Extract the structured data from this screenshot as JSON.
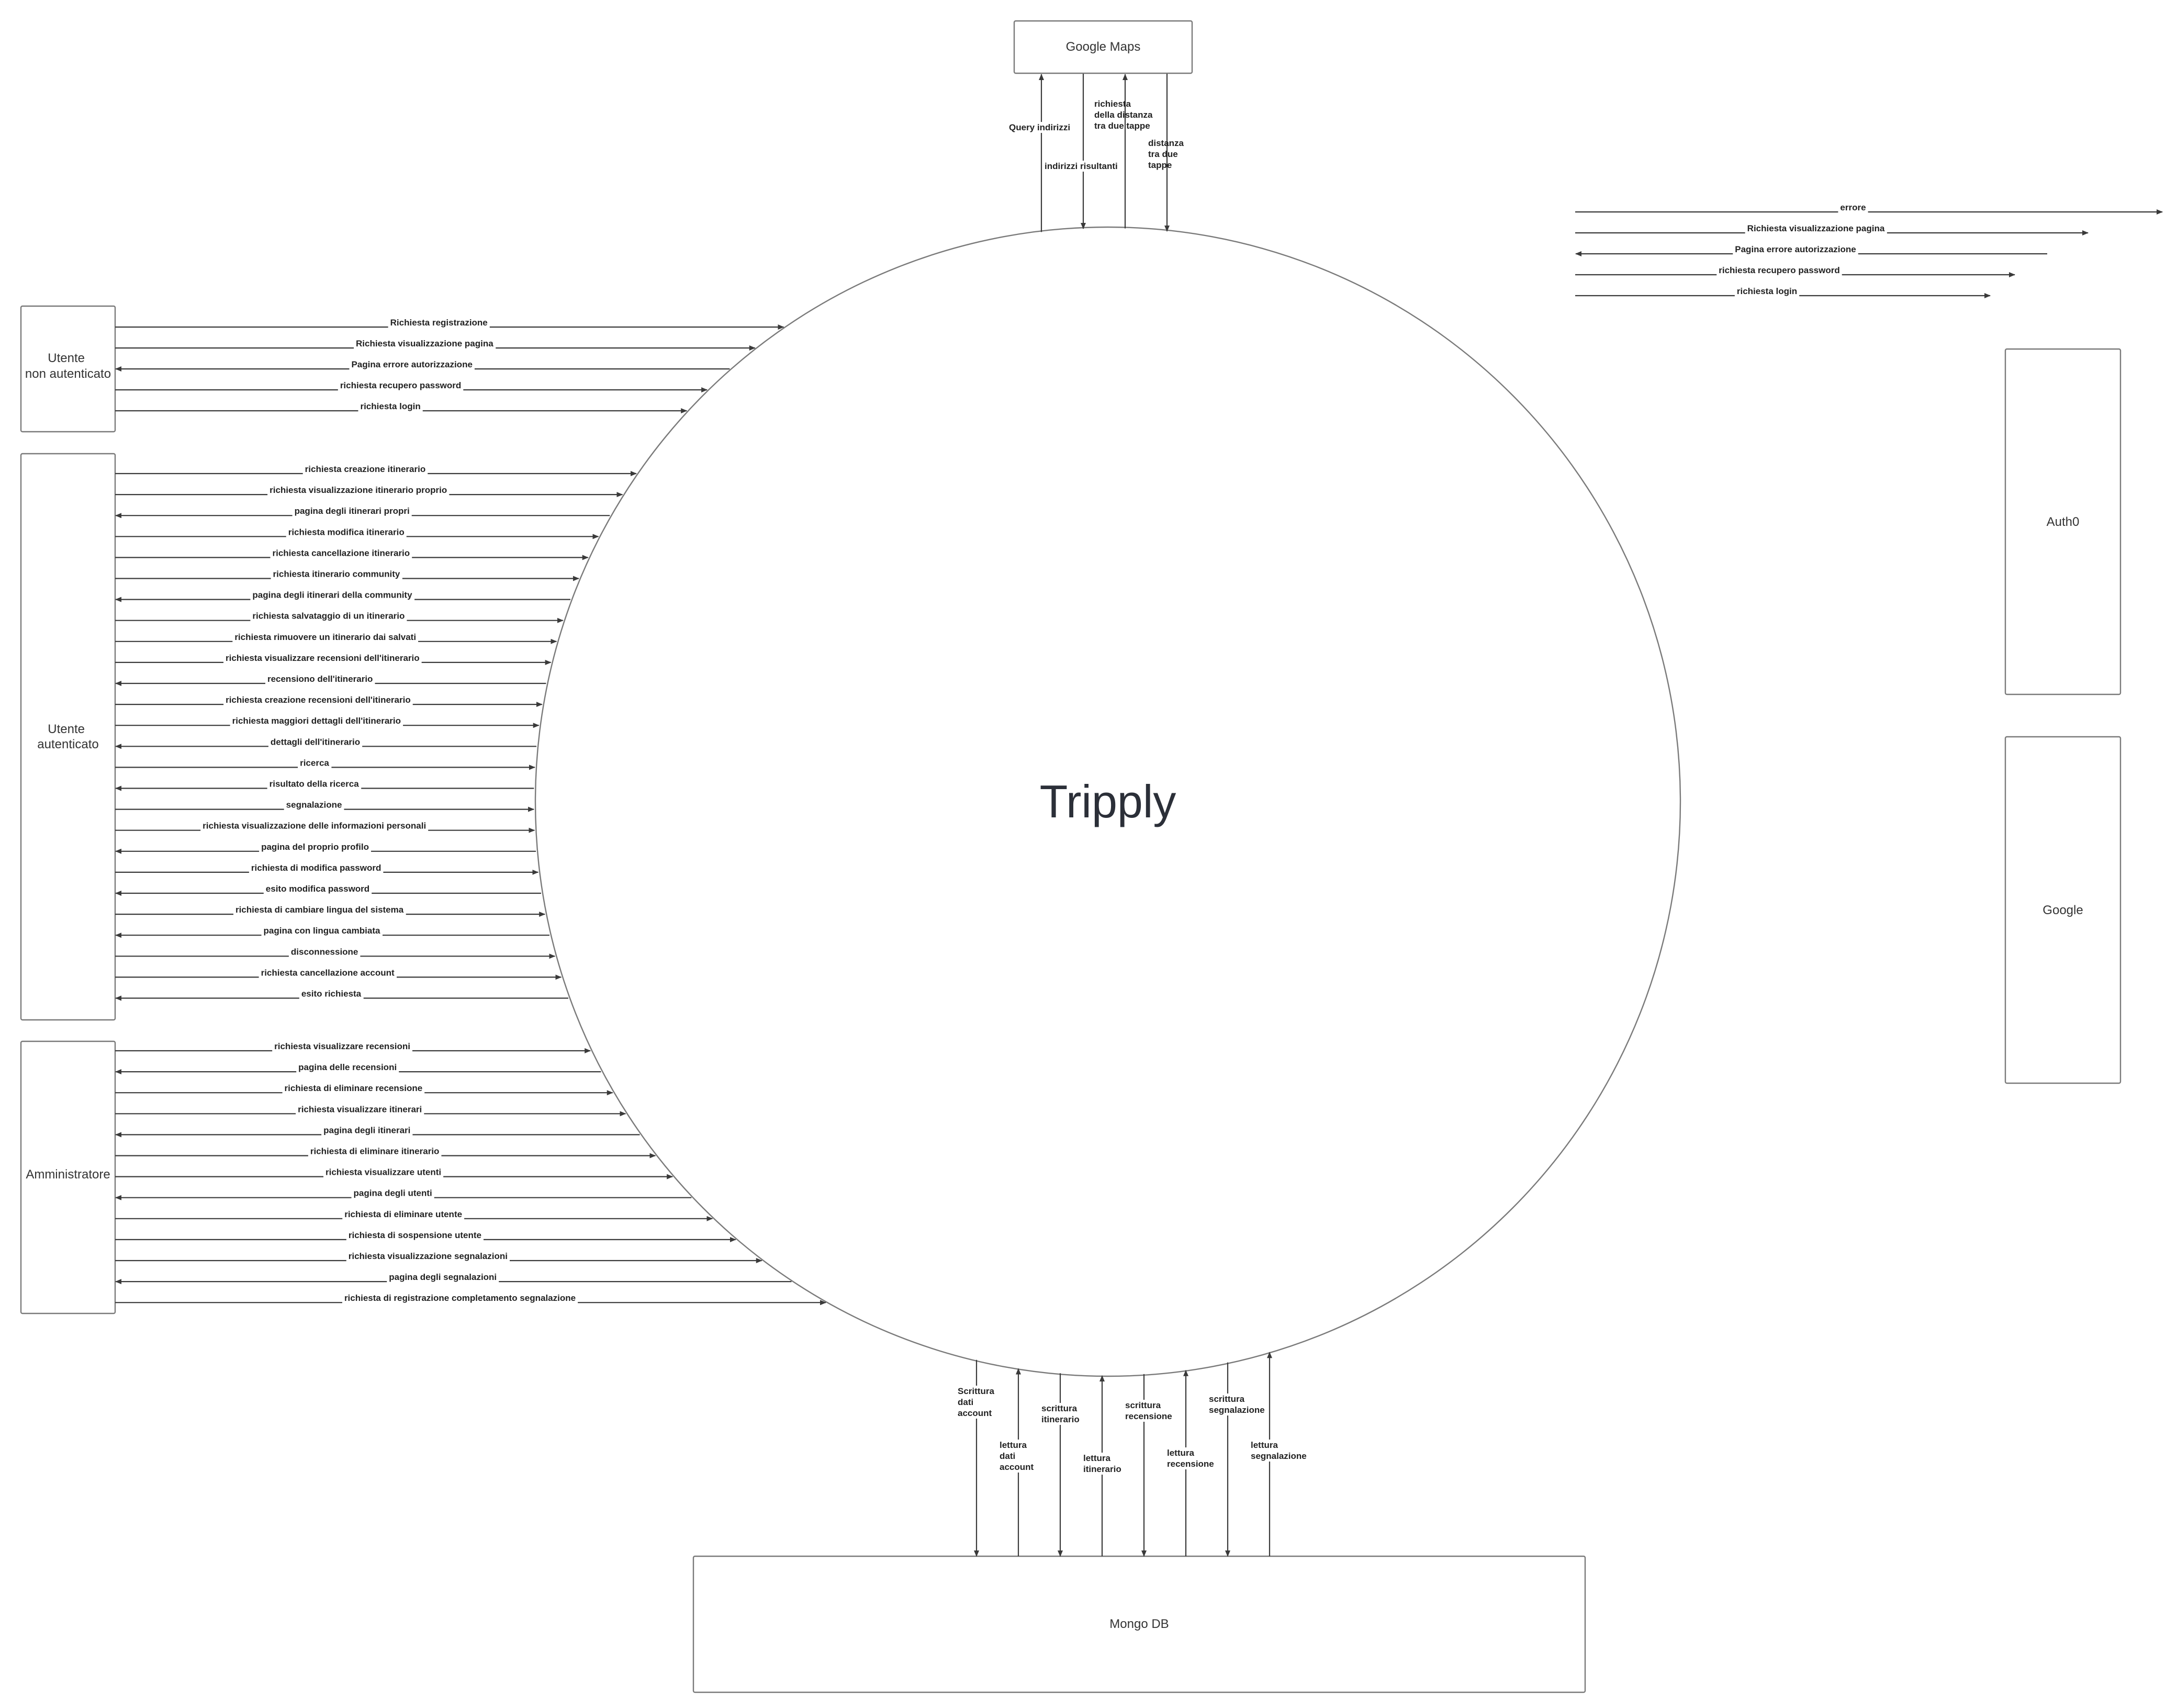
{
  "system": {
    "title": "Tripply"
  },
  "entities": {
    "google_maps": "Google Maps",
    "utente_non_autenticato": [
      "Utente",
      "non autenticato"
    ],
    "utente_autenticato": [
      "Utente",
      "autenticato"
    ],
    "amministratore": "Amministratore",
    "auth0": "Auth0",
    "google": "Google",
    "mongo_db": "Mongo DB"
  },
  "flows": {
    "utente_non_autenticato": [
      {
        "label": "Richiesta registrazione",
        "dir": "in"
      },
      {
        "label": "Richiesta visualizzazione pagina",
        "dir": "in"
      },
      {
        "label": "Pagina errore autorizzazione",
        "dir": "out"
      },
      {
        "label": "richiesta recupero password",
        "dir": "in"
      },
      {
        "label": "richiesta login",
        "dir": "in"
      }
    ],
    "utente_autenticato": [
      {
        "label": "richiesta creazione itinerario",
        "dir": "in"
      },
      {
        "label": "richiesta visualizzazione itinerario proprio",
        "dir": "in"
      },
      {
        "label": "pagina degli itinerari propri",
        "dir": "out"
      },
      {
        "label": "richiesta modifica itinerario",
        "dir": "in"
      },
      {
        "label": "richiesta cancellazione itinerario",
        "dir": "in"
      },
      {
        "label": "richiesta itinerario community",
        "dir": "in"
      },
      {
        "label": "pagina degli itinerari della community",
        "dir": "out"
      },
      {
        "label": "richiesta salvataggio di un itinerario",
        "dir": "in"
      },
      {
        "label": "richiesta rimuovere un itinerario dai salvati",
        "dir": "in"
      },
      {
        "label": "richiesta visualizzare recensioni dell'itinerario",
        "dir": "in"
      },
      {
        "label": "recensiono dell'itinerario",
        "dir": "out"
      },
      {
        "label": "richiesta creazione recensioni dell'itinerario",
        "dir": "in"
      },
      {
        "label": "richiesta maggiori dettagli dell'itinerario",
        "dir": "in"
      },
      {
        "label": "dettagli dell'itinerario",
        "dir": "out"
      },
      {
        "label": "ricerca",
        "dir": "in"
      },
      {
        "label": "risultato della ricerca",
        "dir": "out"
      },
      {
        "label": "segnalazione",
        "dir": "in"
      },
      {
        "label": "richiesta visualizzazione delle informazioni personali",
        "dir": "in"
      },
      {
        "label": "pagina del proprio profilo",
        "dir": "out"
      },
      {
        "label": "richiesta di modifica password",
        "dir": "in"
      },
      {
        "label": "esito modifica password",
        "dir": "out"
      },
      {
        "label": "richiesta di cambiare lingua del sistema",
        "dir": "in"
      },
      {
        "label": "pagina con lingua cambiata",
        "dir": "out"
      },
      {
        "label": "disconnessione",
        "dir": "in"
      },
      {
        "label": "richiesta cancellazione account",
        "dir": "in"
      },
      {
        "label": "esito richiesta",
        "dir": "out"
      }
    ],
    "amministratore": [
      {
        "label": "richiesta visualizzare recensioni",
        "dir": "in"
      },
      {
        "label": "pagina delle recensioni",
        "dir": "out"
      },
      {
        "label": "richiesta di eliminare recensione",
        "dir": "in"
      },
      {
        "label": "richiesta visualizzare itinerari",
        "dir": "in"
      },
      {
        "label": "pagina degli itinerari",
        "dir": "out"
      },
      {
        "label": "richiesta di eliminare itinerario",
        "dir": "in"
      },
      {
        "label": "richiesta visualizzare utenti",
        "dir": "in"
      },
      {
        "label": "pagina degli utenti",
        "dir": "out"
      },
      {
        "label": "richiesta di eliminare utente",
        "dir": "in"
      },
      {
        "label": "richiesta di sospensione utente",
        "dir": "in"
      },
      {
        "label": "richiesta visualizzazione segnalazioni",
        "dir": "in"
      },
      {
        "label": "pagina degli segnalazioni",
        "dir": "out"
      },
      {
        "label": "richiesta di registrazione completamento segnalazione",
        "dir": "in"
      }
    ],
    "auth_side": [
      {
        "label": "errore",
        "dir": "right"
      },
      {
        "label": "Richiesta visualizzazione pagina",
        "dir": "right"
      },
      {
        "label": "Pagina errore autorizzazione",
        "dir": "left"
      },
      {
        "label": "richiesta recupero password",
        "dir": "right"
      },
      {
        "label": "richiesta login",
        "dir": "right"
      }
    ],
    "google_maps": [
      {
        "label": [
          "Query indirizzi"
        ],
        "dir": "up"
      },
      {
        "label": [
          "indirizzi risultanti"
        ],
        "dir": "down"
      },
      {
        "label": [
          "richiesta",
          "della distanza",
          "tra due tappe"
        ],
        "dir": "up"
      },
      {
        "label": [
          "distanza",
          "tra due",
          "tappe"
        ],
        "dir": "down"
      }
    ],
    "mongo_db": [
      {
        "label": [
          "Scrittura",
          "dati",
          "account"
        ],
        "dir": "down"
      },
      {
        "label": [
          "lettura",
          "dati",
          "account"
        ],
        "dir": "up"
      },
      {
        "label": [
          "scrittura",
          "itinerario"
        ],
        "dir": "down"
      },
      {
        "label": [
          "lettura",
          "itinerario"
        ],
        "dir": "up"
      },
      {
        "label": [
          "scrittura",
          "recensione"
        ],
        "dir": "down"
      },
      {
        "label": [
          "lettura",
          "recensione"
        ],
        "dir": "up"
      },
      {
        "label": [
          "scrittura",
          "segnalazione"
        ],
        "dir": "down"
      },
      {
        "label": [
          "lettura",
          "segnalazione"
        ],
        "dir": "up"
      }
    ]
  }
}
